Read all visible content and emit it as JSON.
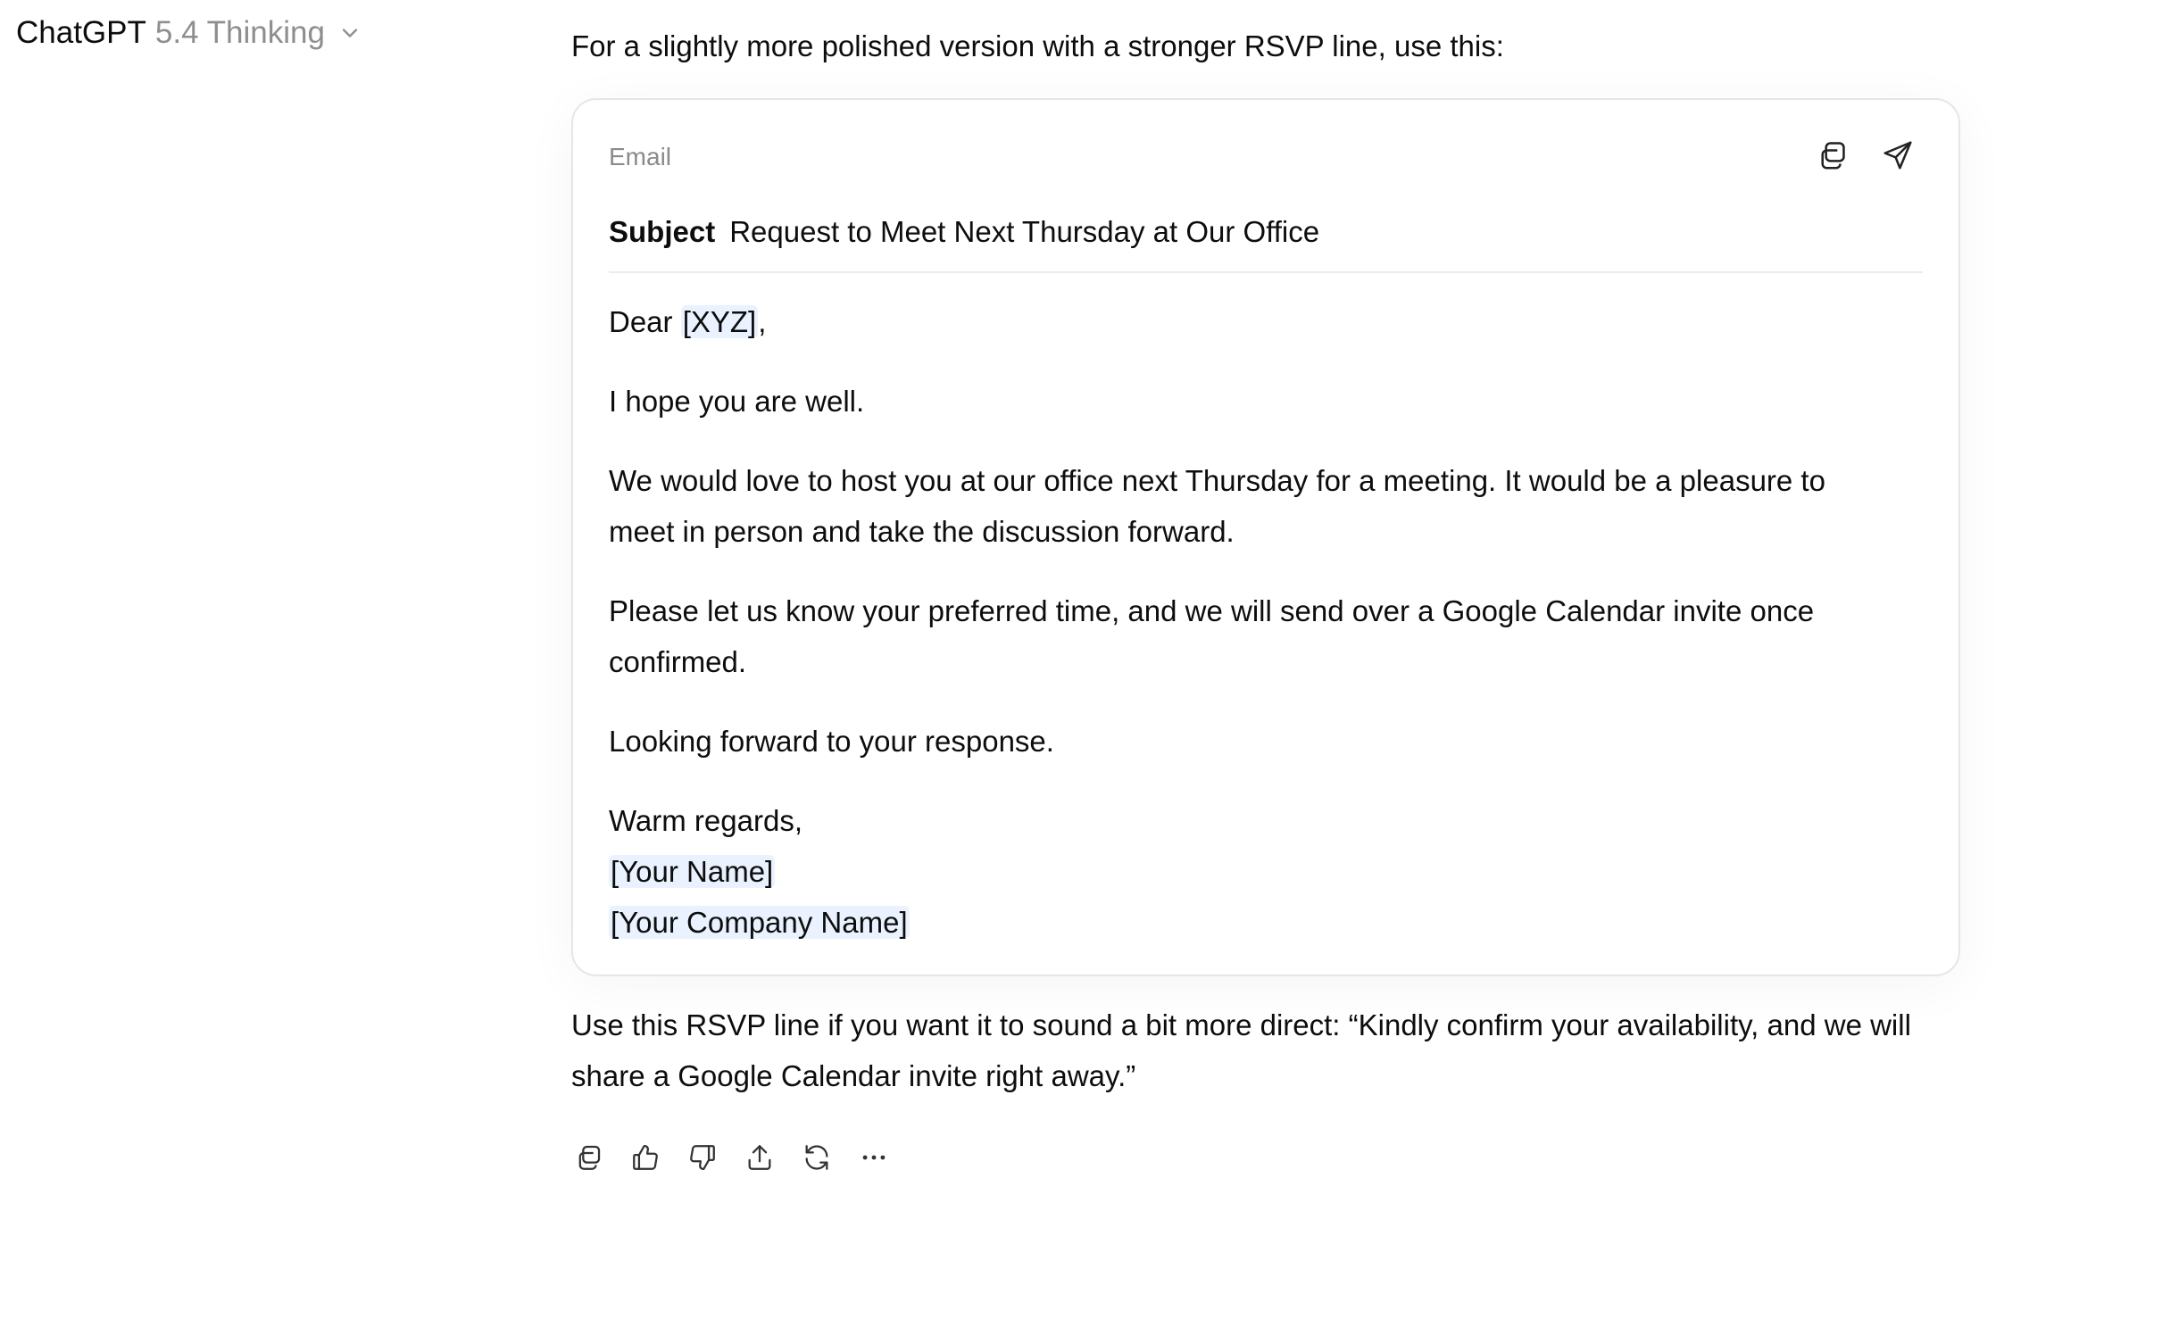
{
  "header": {
    "model_name": "ChatGPT",
    "model_version": "5.4 Thinking"
  },
  "message": {
    "intro": "For a slightly more polished version with a stronger RSVP line, use this:",
    "email": {
      "label": "Email",
      "subject_key": "Subject",
      "subject_value": "Request to Meet Next Thursday at Our Office",
      "greeting_prefix": "Dear ",
      "greeting_placeholder": "[XYZ]",
      "greeting_suffix": ",",
      "para1": "I hope you are well.",
      "para2": "We would love to host you at our office next Thursday for a meeting. It would be a pleasure to meet in person and take the discussion forward.",
      "para3": "Please let us know your preferred time, and we will send over a Google Calendar invite once confirmed.",
      "para4": "Looking forward to your response.",
      "closing": "Warm regards,",
      "sig_name": "[Your Name]",
      "sig_company": "[Your Company Name]"
    },
    "outro": "Use this RSVP line if you want it to sound a bit more direct: “Kindly confirm your availability, and we will share a Google Calendar invite right away.”"
  },
  "icons": {
    "card_actions": [
      "copy-icon",
      "send-icon"
    ],
    "toolbar": [
      "copy-icon",
      "thumbs-up-icon",
      "thumbs-down-icon",
      "share-icon",
      "regenerate-icon",
      "more-icon"
    ]
  },
  "colors": {
    "placeholder_highlight": "#e9f2fe",
    "muted_text": "#8e8e8e",
    "card_border": "#e6e6e6"
  }
}
